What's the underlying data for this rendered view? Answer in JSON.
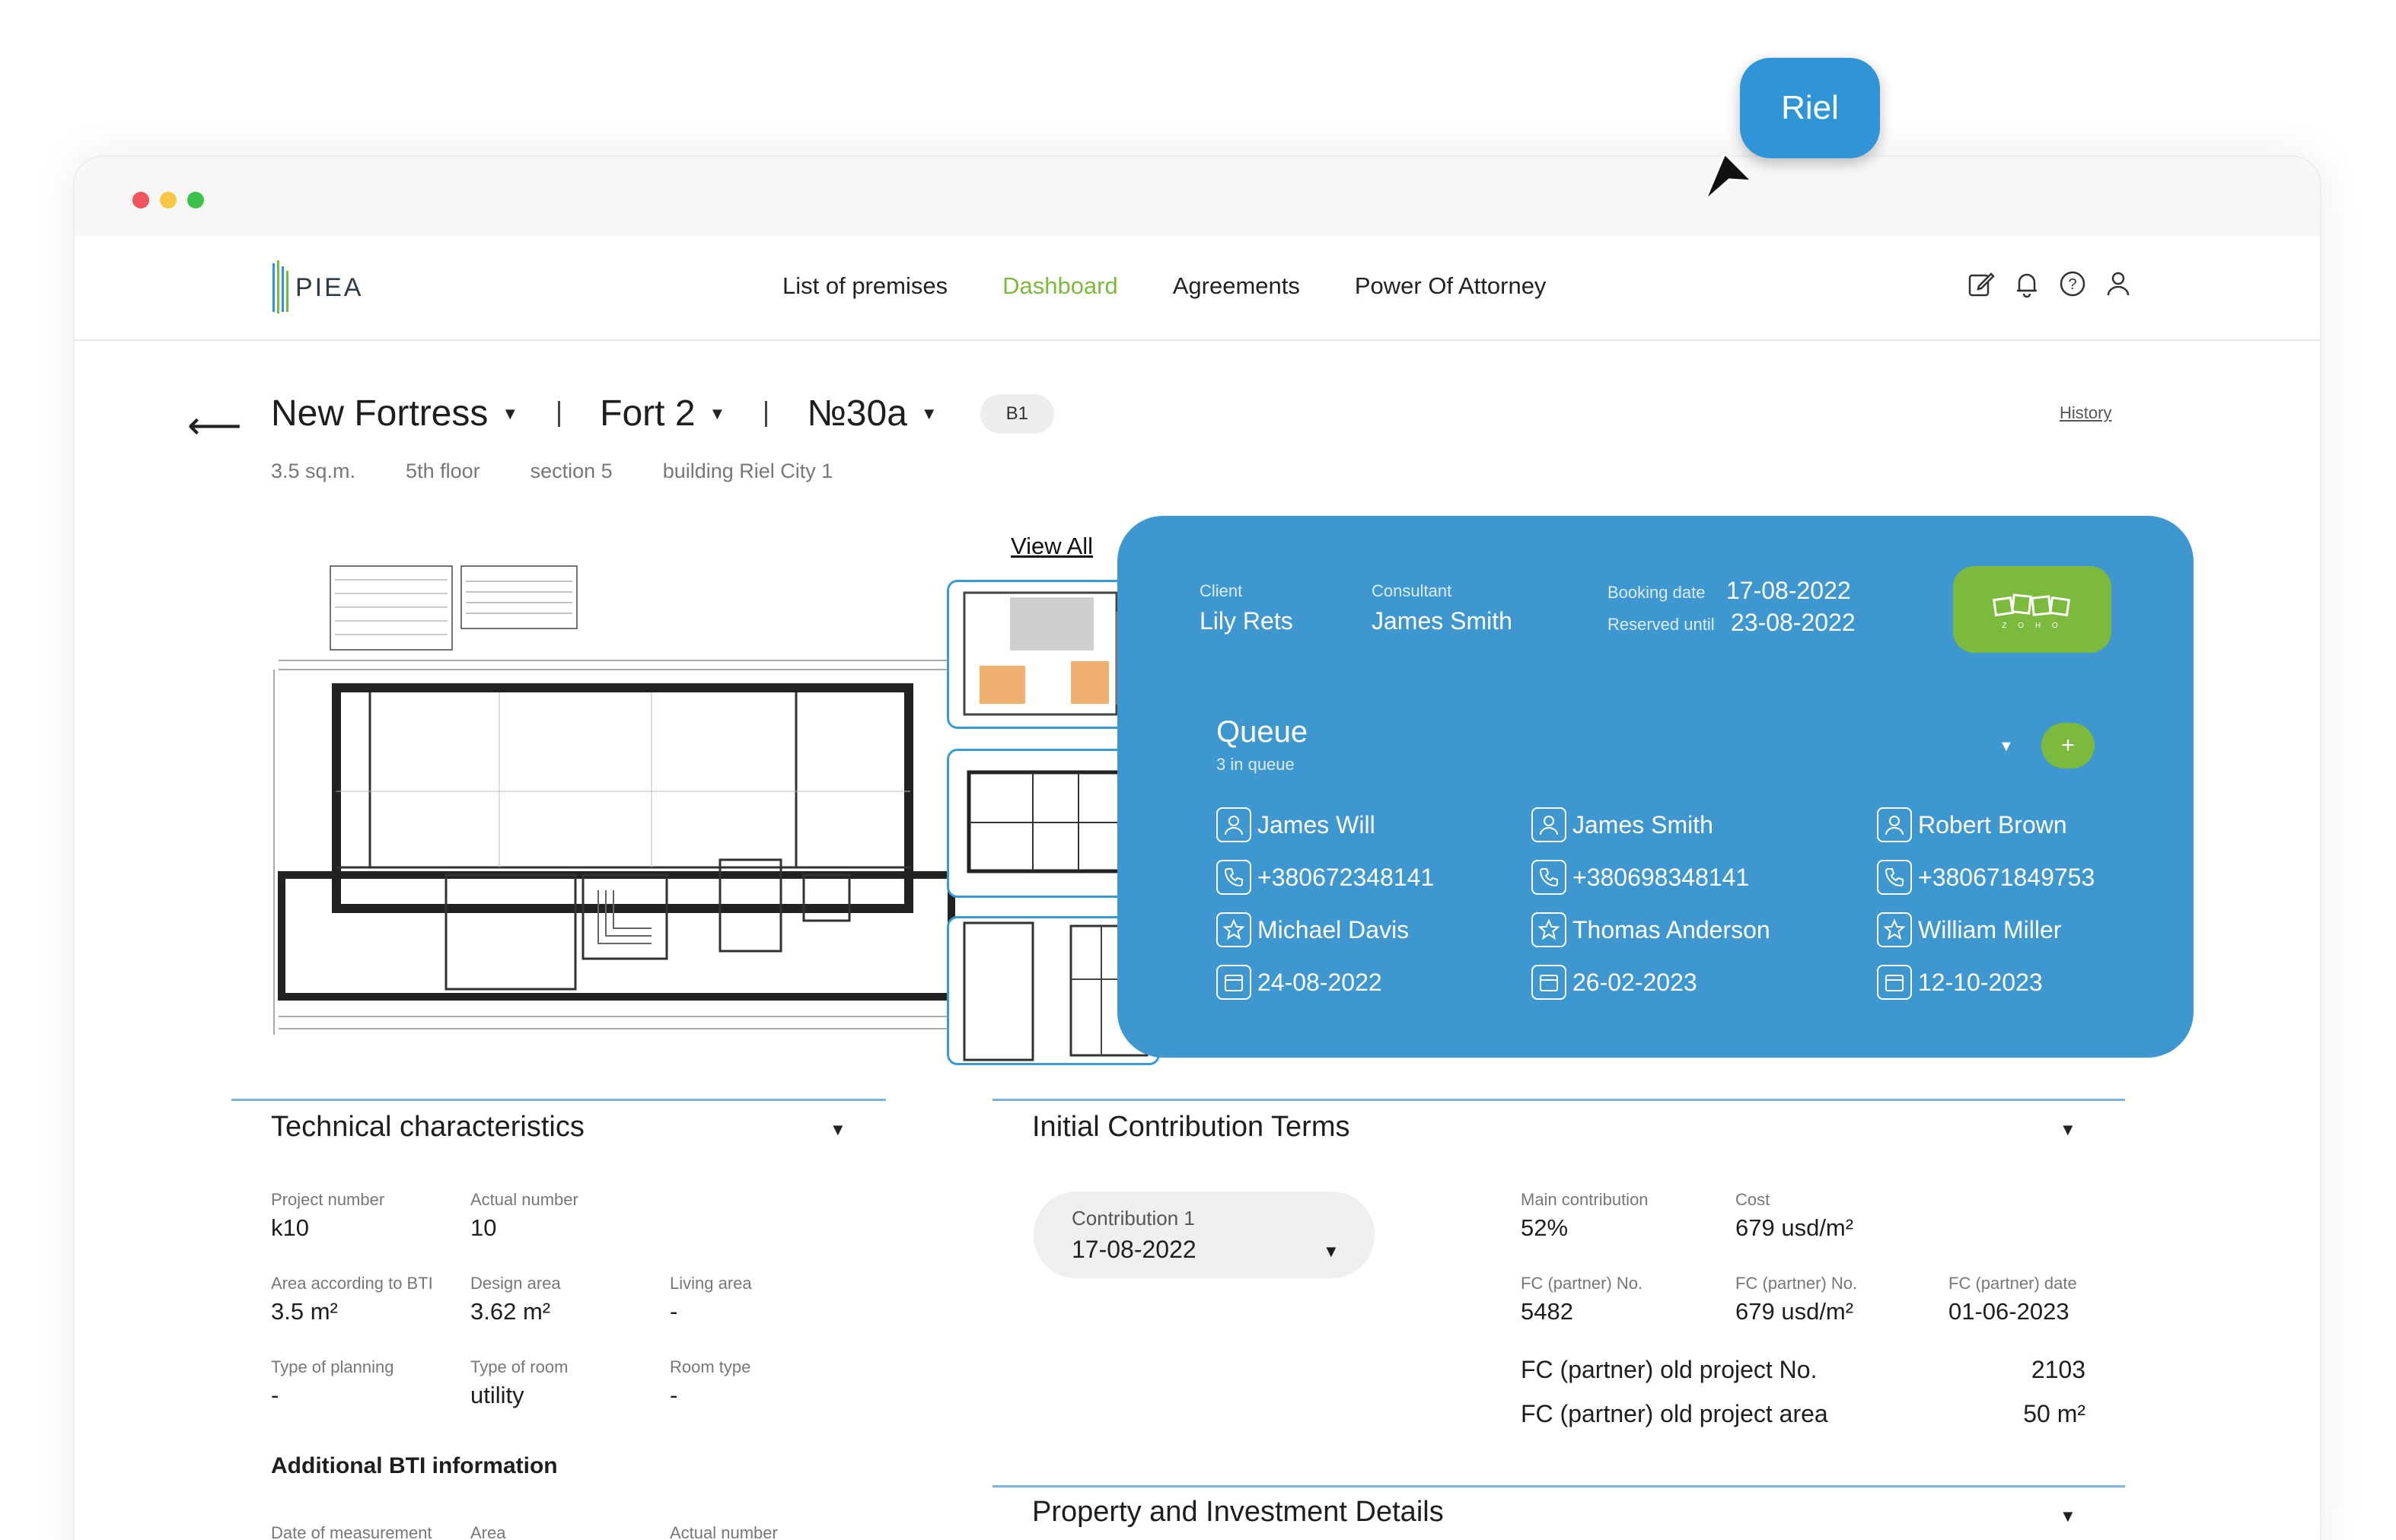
{
  "cursor": {
    "label": "Riel"
  },
  "header": {
    "logo_text": "PIEA",
    "nav": [
      {
        "label": "List of premises",
        "active": false
      },
      {
        "label": "Dashboard",
        "active": true
      },
      {
        "label": "Agreements",
        "active": false
      },
      {
        "label": "Power Of Attorney",
        "active": false
      }
    ],
    "icons": [
      "edit-icon",
      "bell-icon",
      "help-icon",
      "user-icon"
    ]
  },
  "title": {
    "crumbs": [
      "New Fortress",
      "Fort 2",
      "№30a"
    ],
    "badge": "B1",
    "history": "History",
    "meta": [
      "3.5 sq.m.",
      "5th floor",
      "section 5",
      "building Riel City 1"
    ]
  },
  "gallery": {
    "view_all": "View All"
  },
  "panel": {
    "client_label": "Client",
    "client": "Lily Rets",
    "consultant_label": "Consultant",
    "consultant": "James Smith",
    "booking_label": "Booking date",
    "booking": "17-08-2022",
    "reserved_label": "Reserved until",
    "reserved": "23-08-2022",
    "zoho": "Z O H O",
    "queue_title": "Queue",
    "queue_sub": "3 in queue",
    "add": "+",
    "queue": [
      {
        "name": "James Will",
        "phone": "+380672348141",
        "agent": "Michael Davis",
        "date": "24-08-2022"
      },
      {
        "name": "James Smith",
        "phone": "+380698348141",
        "agent": "Thomas Anderson",
        "date": "26-02-2023"
      },
      {
        "name": "Robert Brown",
        "phone": "+380671849753",
        "agent": "William Miller",
        "date": "12-10-2023"
      }
    ]
  },
  "technical": {
    "title": "Technical characteristics",
    "fields": [
      {
        "label": "Project number",
        "value": "k10"
      },
      {
        "label": "Actual number",
        "value": "10"
      },
      {
        "label": "Area according to BTI",
        "value": "3.5 m²"
      },
      {
        "label": "Design area",
        "value": "3.62 m²"
      },
      {
        "label": "Living area",
        "value": "-"
      },
      {
        "label": "Type of planning",
        "value": "-"
      },
      {
        "label": "Type of room",
        "value": "utility"
      },
      {
        "label": "Room type",
        "value": "-"
      }
    ],
    "additional": "Additional BTI information",
    "more_labels": [
      "Date of measurement",
      "Area",
      "Actual number"
    ]
  },
  "contribution": {
    "title": "Initial Contribution Terms",
    "pill_label": "Contribution 1",
    "pill_value": "17-08-2022",
    "fields": [
      {
        "label": "Main contribution",
        "value": "52%"
      },
      {
        "label": "Cost",
        "value": "679 usd/m²"
      },
      {
        "label": "FC (partner) No.",
        "value": "5482"
      },
      {
        "label": "FC (partner) No.",
        "value": "679 usd/m²"
      },
      {
        "label": "FC (partner) date",
        "value": "01-06-2023"
      }
    ],
    "old_rows": [
      {
        "label": "FC (partner) old project No.",
        "value": "2103"
      },
      {
        "label": "FC (partner) old project area",
        "value": "50 m²"
      }
    ]
  },
  "property": {
    "title": "Property and Investment Details"
  },
  "colors": {
    "accent_green": "#7cba3d",
    "panel_blue": "#3f97cf"
  }
}
